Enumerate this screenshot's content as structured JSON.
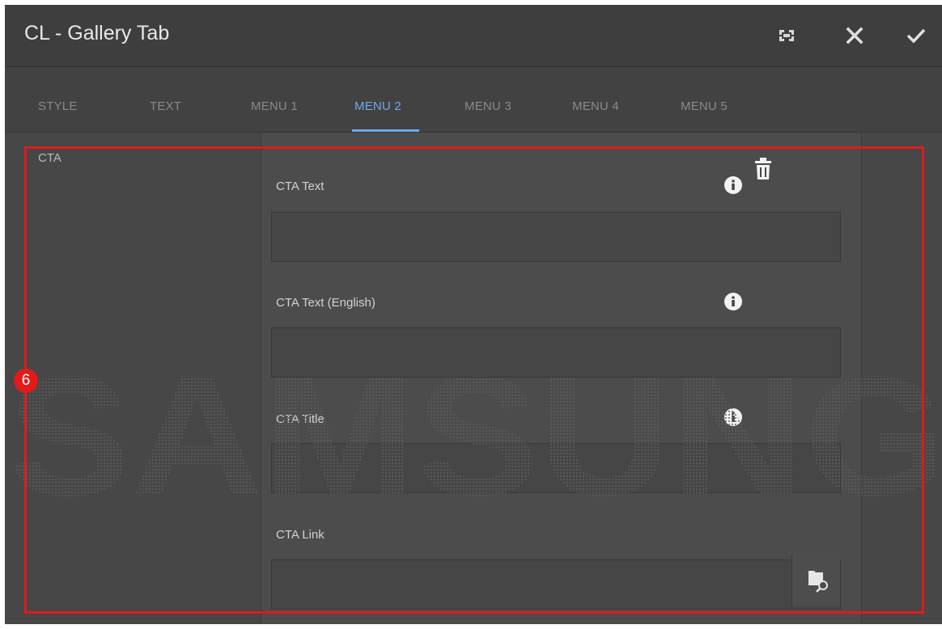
{
  "dialog": {
    "title": "CL - Gallery Tab",
    "buttons": {
      "fullscreen": "fullscreen-icon",
      "close": "close-icon",
      "confirm": "checkmark-icon"
    }
  },
  "tabs": [
    {
      "label": "STYLE",
      "active": false
    },
    {
      "label": "TEXT",
      "active": false
    },
    {
      "label": "MENU 1",
      "active": false
    },
    {
      "label": "MENU 2",
      "active": true
    },
    {
      "label": "MENU 3",
      "active": false
    },
    {
      "label": "MENU 4",
      "active": false
    },
    {
      "label": "MENU 5",
      "active": false
    }
  ],
  "section": {
    "label": "CTA"
  },
  "fields": [
    {
      "label": "CTA Text",
      "value": "",
      "has_info": true
    },
    {
      "label": "CTA Text (English)",
      "value": "",
      "has_info": true
    },
    {
      "label": "CTA Title",
      "value": "",
      "has_info": true
    },
    {
      "label": "CTA Link",
      "value": "",
      "has_browse": true
    }
  ],
  "watermark": {
    "text": "SAMSUNG"
  },
  "annotation": {
    "number": "6",
    "color": "#e21a1a"
  },
  "colors": {
    "accent": "#6fa9ea",
    "background": "#474747"
  }
}
